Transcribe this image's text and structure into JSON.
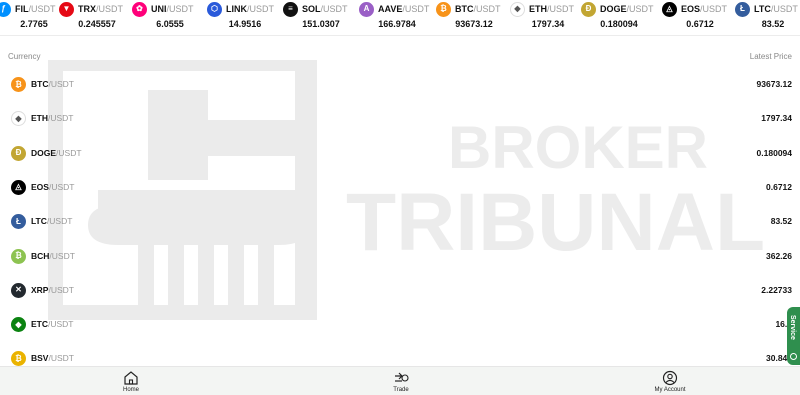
{
  "ticker": [
    {
      "symbol": "FIL",
      "quote": "/USDT",
      "price": "2.7765",
      "icon": "fil-icon",
      "color": "#0090ff",
      "glyph": "ƒ"
    },
    {
      "symbol": "TRX",
      "quote": "/USDT",
      "price": "0.245557",
      "icon": "trx-icon",
      "color": "#e50915",
      "glyph": "▼"
    },
    {
      "symbol": "UNI",
      "quote": "/USDT",
      "price": "6.0555",
      "icon": "uni-icon",
      "color": "#ff007a",
      "glyph": "✿"
    },
    {
      "symbol": "LINK",
      "quote": "/USDT",
      "price": "14.9516",
      "icon": "link-icon",
      "color": "#2a5ada",
      "glyph": "⬡"
    },
    {
      "symbol": "SOL",
      "quote": "/USDT",
      "price": "151.0307",
      "icon": "sol-icon",
      "color": "#111111",
      "glyph": "≡"
    },
    {
      "symbol": "AAVE",
      "quote": "/USDT",
      "price": "166.9784",
      "icon": "aave-icon",
      "color": "#9a5fc6",
      "glyph": "A"
    },
    {
      "symbol": "BTC",
      "quote": "/USDT",
      "price": "93673.12",
      "icon": "btc-icon",
      "color": "#f7931a",
      "glyph": "₿"
    },
    {
      "symbol": "ETH",
      "quote": "/USDT",
      "price": "1797.34",
      "icon": "eth-icon",
      "color": "#ffffff",
      "glyph": "◆"
    },
    {
      "symbol": "DOGE",
      "quote": "/USDT",
      "price": "0.180094",
      "icon": "doge-icon",
      "color": "#c2a633",
      "glyph": "Ð"
    },
    {
      "symbol": "EOS",
      "quote": "/USDT",
      "price": "0.6712",
      "icon": "eos-icon",
      "color": "#000000",
      "glyph": "◬"
    },
    {
      "symbol": "LTC",
      "quote": "/USDT",
      "price": "83.52",
      "icon": "ltc-icon",
      "color": "#345d9d",
      "glyph": "Ł"
    }
  ],
  "market": {
    "currency_header": "Currency",
    "price_header": "Latest Price",
    "rows": [
      {
        "symbol": "BTC",
        "quote": "/USDT",
        "price": "93673.12",
        "icon": "btc-icon",
        "color": "#f7931a",
        "glyph": "₿"
      },
      {
        "symbol": "ETH",
        "quote": "/USDT",
        "price": "1797.34",
        "icon": "eth-icon",
        "color": "#ffffff",
        "glyph": "◆"
      },
      {
        "symbol": "DOGE",
        "quote": "/USDT",
        "price": "0.180094",
        "icon": "doge-icon",
        "color": "#c2a633",
        "glyph": "Ð"
      },
      {
        "symbol": "EOS",
        "quote": "/USDT",
        "price": "0.6712",
        "icon": "eos-icon",
        "color": "#000000",
        "glyph": "◬"
      },
      {
        "symbol": "LTC",
        "quote": "/USDT",
        "price": "83.52",
        "icon": "ltc-icon",
        "color": "#345d9d",
        "glyph": "Ł"
      },
      {
        "symbol": "BCH",
        "quote": "/USDT",
        "price": "362.26",
        "icon": "bch-icon",
        "color": "#8dc351",
        "glyph": "₿"
      },
      {
        "symbol": "XRP",
        "quote": "/USDT",
        "price": "2.22733",
        "icon": "xrp-icon",
        "color": "#23292f",
        "glyph": "✕"
      },
      {
        "symbol": "ETC",
        "quote": "/USDT",
        "price": "16.8",
        "icon": "etc-icon",
        "color": "#0b8311",
        "glyph": "◆"
      },
      {
        "symbol": "BSV",
        "quote": "/USDT",
        "price": "30.848",
        "icon": "bsv-icon",
        "color": "#eab300",
        "glyph": "₿"
      }
    ]
  },
  "watermark": {
    "line1": "BROKER",
    "line2": "TRIBUNAL",
    "color": "#e9e9e9"
  },
  "service": {
    "label": "Service"
  },
  "nav": {
    "home": "Home",
    "trade": "Trade",
    "account": "My Account"
  }
}
